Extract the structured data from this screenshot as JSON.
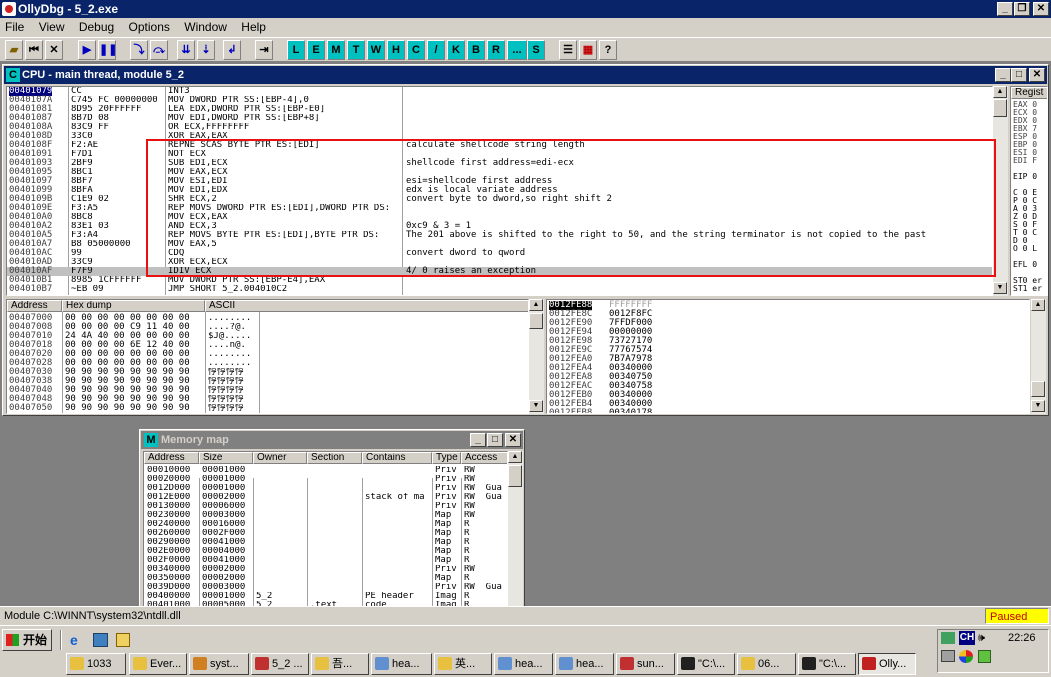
{
  "app": {
    "title": "OllyDbg - 5_2.exe"
  },
  "menu": [
    "File",
    "View",
    "Debug",
    "Options",
    "Window",
    "Help"
  ],
  "toolbar_letters": [
    "L",
    "E",
    "M",
    "T",
    "W",
    "H",
    "C",
    "/",
    "K",
    "B",
    "R",
    "...",
    "S"
  ],
  "cpu": {
    "title": "CPU - main thread, module 5_2",
    "selected_addr": "00401079",
    "current_addr": "004010AF",
    "regs_header": "Regist",
    "regs": [
      "EAX 0",
      "ECX 0",
      "EDX 0",
      "EBX 7",
      "ESP 0",
      "EBP 0",
      "ESI 0",
      "EDI F",
      "",
      "EIP 0",
      "",
      "C 0 E",
      "P 0 C",
      "A 0 3",
      "Z 0 D",
      "S 0 F",
      "T 0 C",
      "D 0",
      "O 0 L",
      "",
      "EFL 0",
      "",
      "ST0 er",
      "ST1 er"
    ],
    "rows": [
      {
        "addr": "00401079",
        "hex": "CC",
        "asm": "INT3",
        "cmt": ""
      },
      {
        "addr": "0040107A",
        "hex": "C745 FC 00000000",
        "asm": "MOV DWORD PTR SS:[EBP-4],0",
        "cmt": ""
      },
      {
        "addr": "00401081",
        "hex": "8D95 20FFFFFF",
        "asm": "LEA EDX,DWORD PTR SS:[EBP-E0]",
        "cmt": ""
      },
      {
        "addr": "00401087",
        "hex": "8B7D 08",
        "asm": "MOV EDI,DWORD PTR SS:[EBP+8]",
        "cmt": ""
      },
      {
        "addr": "0040108A",
        "hex": "83C9 FF",
        "asm": "OR ECX,FFFFFFFF",
        "cmt": ""
      },
      {
        "addr": "0040108D",
        "hex": "33C0",
        "asm": "XOR EAX,EAX",
        "cmt": ""
      },
      {
        "addr": "0040108F",
        "hex": "F2:AE",
        "asm": "REPNE SCAS BYTE PTR ES:[EDI]",
        "cmt": "calculate shellcode string length"
      },
      {
        "addr": "00401091",
        "hex": "F7D1",
        "asm": "NOT ECX",
        "cmt": ""
      },
      {
        "addr": "00401093",
        "hex": "2BF9",
        "asm": "SUB EDI,ECX",
        "cmt": "shellcode first address=edi-ecx"
      },
      {
        "addr": "00401095",
        "hex": "8BC1",
        "asm": "MOV EAX,ECX",
        "cmt": ""
      },
      {
        "addr": "00401097",
        "hex": "8BF7",
        "asm": "MOV ESI,EDI",
        "cmt": "esi=shellcode first address"
      },
      {
        "addr": "00401099",
        "hex": "8BFA",
        "asm": "MOV EDI,EDX",
        "cmt": "edx is local variate address"
      },
      {
        "addr": "0040109B",
        "hex": "C1E9 02",
        "asm": "SHR ECX,2",
        "cmt": "convert byte to dword,so right shift 2"
      },
      {
        "addr": "0040109E",
        "hex": "F3:A5",
        "asm": "REP MOVS DWORD PTR ES:[EDI],DWORD PTR DS:",
        "cmt": ""
      },
      {
        "addr": "004010A0",
        "hex": "8BC8",
        "asm": "MOV ECX,EAX",
        "cmt": ""
      },
      {
        "addr": "004010A2",
        "hex": "83E1 03",
        "asm": "AND ECX,3",
        "cmt": "0xc9 & 3 = 1"
      },
      {
        "addr": "004010A5",
        "hex": "F3:A4",
        "asm": "REP MOVS BYTE PTR ES:[EDI],BYTE PTR DS:",
        "cmt": "The 201 above is shifted to the right to 50, and the string terminator is not copied to the past"
      },
      {
        "addr": "004010A7",
        "hex": "B8 05000000",
        "asm": "MOV EAX,5",
        "cmt": ""
      },
      {
        "addr": "004010AC",
        "hex": "99",
        "asm": "CDQ",
        "cmt": "convert dword to qword"
      },
      {
        "addr": "004010AD",
        "hex": "33C9",
        "asm": "XOR ECX,ECX",
        "cmt": ""
      },
      {
        "addr": "004010AF",
        "hex": "F7F9",
        "asm": "IDIV ECX",
        "cmt": "4/ 0 raises an exception"
      },
      {
        "addr": "004010B1",
        "hex": "8985 1CFFFFFF",
        "asm": "MOV DWORD PTR SS:[EBP-E4],EAX",
        "cmt": ""
      },
      {
        "addr": "004010B7",
        "hex": "~EB 09",
        "asm": "JMP SHORT 5_2.004010C2",
        "cmt": ""
      }
    ]
  },
  "dump": {
    "headers": [
      "Address",
      "Hex dump",
      "ASCII"
    ],
    "rows": [
      {
        "addr": "00407000",
        "hex": "00 00 00 00 00 00 00 00",
        "asc": "........"
      },
      {
        "addr": "00407008",
        "hex": "00 00 00 00 C9 11 40 00",
        "asc": "....?@."
      },
      {
        "addr": "00407010",
        "hex": "24 4A 40 00 00 00 00 00",
        "asc": "$J@....."
      },
      {
        "addr": "00407018",
        "hex": "00 00 00 00 6E 12 40 00",
        "asc": "....n@."
      },
      {
        "addr": "00407020",
        "hex": "00 00 00 00 00 00 00 00",
        "asc": "........"
      },
      {
        "addr": "00407028",
        "hex": "00 00 00 00 00 00 00 00",
        "asc": "........"
      },
      {
        "addr": "00407030",
        "hex": "90 90 90 90 90 90 90 90",
        "asc": "悙悙悙悙"
      },
      {
        "addr": "00407038",
        "hex": "90 90 90 90 90 90 90 90",
        "asc": "悙悙悙悙"
      },
      {
        "addr": "00407040",
        "hex": "90 90 90 90 90 90 90 90",
        "asc": "悙悙悙悙"
      },
      {
        "addr": "00407048",
        "hex": "90 90 90 90 90 90 90 90",
        "asc": "悙悙悙悙"
      },
      {
        "addr": "00407050",
        "hex": "90 90 90 90 90 90 90 90",
        "asc": "悙悙悙悙"
      }
    ]
  },
  "stack": {
    "rows": [
      {
        "addr": "0012FE88",
        "val": "FFFFFFFF"
      },
      {
        "addr": "0012FE8C",
        "val": "0012F8FC"
      },
      {
        "addr": "0012FE90",
        "val": "7FFDF000"
      },
      {
        "addr": "0012FE94",
        "val": "00000000"
      },
      {
        "addr": "0012FE98",
        "val": "73727170"
      },
      {
        "addr": "0012FE9C",
        "val": "77767574"
      },
      {
        "addr": "0012FEA0",
        "val": "7B7A7978"
      },
      {
        "addr": "0012FEA4",
        "val": "00340000"
      },
      {
        "addr": "0012FEA8",
        "val": "00340750"
      },
      {
        "addr": "0012FEAC",
        "val": "00340758"
      },
      {
        "addr": "0012FEB0",
        "val": "00340000"
      },
      {
        "addr": "0012FEB4",
        "val": "00340000"
      },
      {
        "addr": "0012FEB8",
        "val": "00340178"
      }
    ]
  },
  "memmap": {
    "title": "Memory map",
    "headers": [
      "Address",
      "Size",
      "Owner",
      "Section",
      "Contains",
      "Type",
      "Access"
    ],
    "rows": [
      [
        "00010000",
        "00001000",
        "",
        "",
        "",
        "Priv",
        "RW"
      ],
      [
        "00020000",
        "00001000",
        "",
        "",
        "",
        "Priv",
        "RW"
      ],
      [
        "0012D000",
        "00001000",
        "",
        "",
        "",
        "Priv",
        "RW  Gua"
      ],
      [
        "0012E000",
        "00002000",
        "",
        "",
        "stack of ma",
        "Priv",
        "RW  Gua"
      ],
      [
        "00130000",
        "00006000",
        "",
        "",
        "",
        "Priv",
        "RW"
      ],
      [
        "00230000",
        "00003000",
        "",
        "",
        "",
        "Map",
        "RW"
      ],
      [
        "00240000",
        "00016000",
        "",
        "",
        "",
        "Map",
        "R"
      ],
      [
        "00260000",
        "0002F000",
        "",
        "",
        "",
        "Map",
        "R"
      ],
      [
        "00290000",
        "00041000",
        "",
        "",
        "",
        "Map",
        "R"
      ],
      [
        "002E0000",
        "00004000",
        "",
        "",
        "",
        "Map",
        "R"
      ],
      [
        "002F0000",
        "00041000",
        "",
        "",
        "",
        "Map",
        "R"
      ],
      [
        "00340000",
        "00002000",
        "",
        "",
        "",
        "Priv",
        "RW"
      ],
      [
        "00350000",
        "00002000",
        "",
        "",
        "",
        "Map",
        "R"
      ],
      [
        "0039D000",
        "00003000",
        "",
        "",
        "",
        "Priv",
        "RW  Gua"
      ],
      [
        "00400000",
        "00001000",
        "5_2",
        "",
        "PE header",
        "Imag",
        "R"
      ],
      [
        "00401000",
        "00005000",
        "5_2",
        ".text",
        "code",
        "Imag",
        "R"
      ]
    ]
  },
  "status": {
    "text": "Module C:\\WINNT\\system32\\ntdll.dll",
    "state": "Paused"
  },
  "taskbar": {
    "start": "开始",
    "time": "22:26",
    "lang": "CH",
    "tasks": [
      "1033",
      "Ever...",
      "syst...",
      "5_2 ...",
      "吾...",
      "hea...",
      "英...",
      "hea...",
      "hea...",
      "sun...",
      "\"C:\\...",
      "06...",
      "\"C:\\...",
      "Olly..."
    ]
  },
  "colors": {
    "titlebar": "#0a246a",
    "highlight_box": "#e81010",
    "current_line": "#c0c0c0",
    "selected_addr_bg": "#000080",
    "paused_bg": "#ffff00"
  }
}
